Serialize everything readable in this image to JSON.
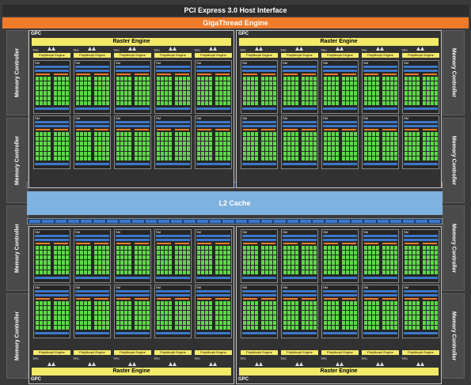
{
  "header": {
    "pcie_label": "PCI Express 3.0 Host Interface",
    "gigathread_label": "GigaThread Engine"
  },
  "memory_controller_label": "Memory Controller",
  "l2_cache_label": "L2 Cache",
  "gpc_label": "GPC",
  "raster_engine_label": "Raster Engine",
  "tpc_label": "TPC",
  "polymorph_label": "PolyMorph Engine",
  "sm_label": "SM",
  "colors": {
    "chip_background": "#3a3a3a",
    "gigathread": "#f07c2a",
    "l2_cache": "#7fb2de",
    "raster_engine": "#f3ea6a",
    "cuda_core": "#5fd84a",
    "register_bar": "#3c78c8"
  }
}
